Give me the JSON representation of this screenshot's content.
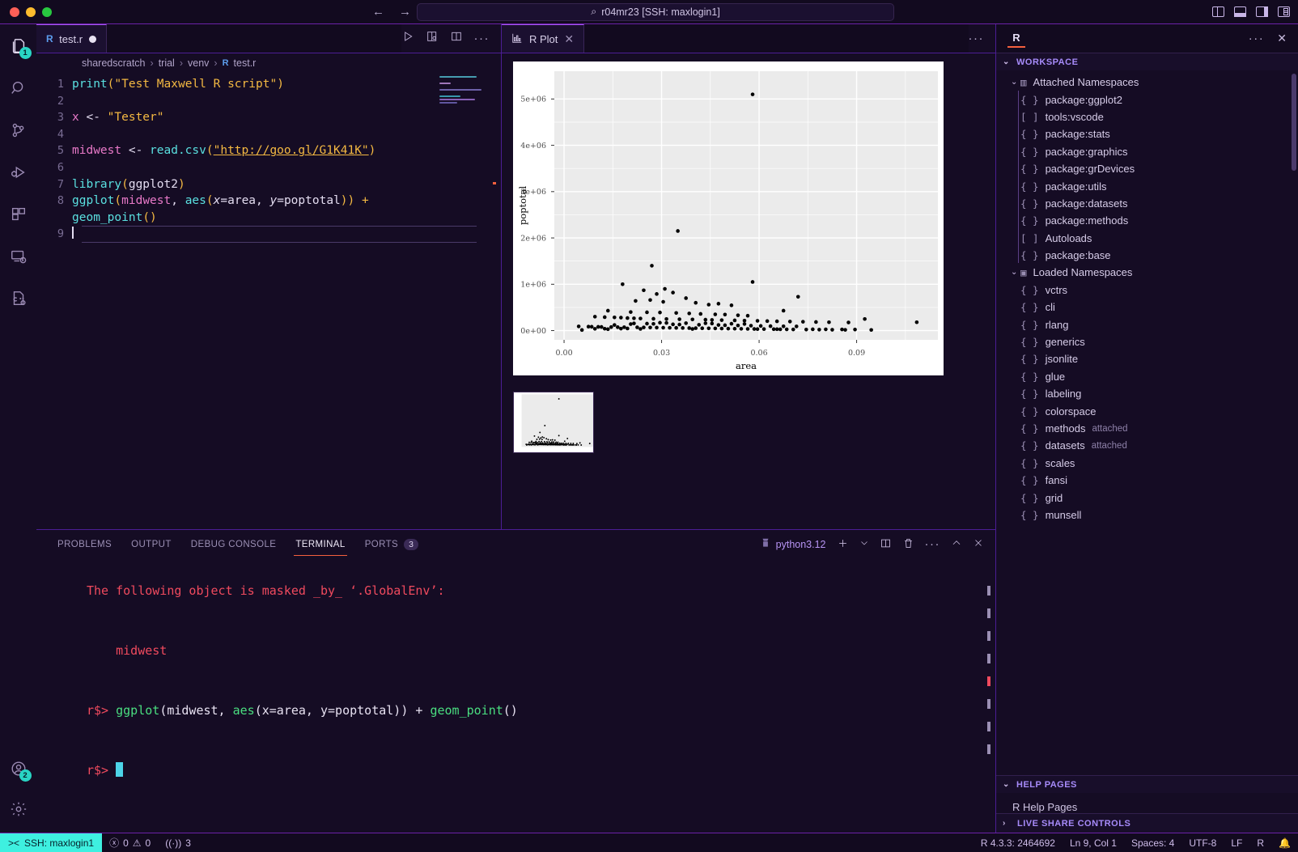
{
  "titlebar": {
    "window_title": "r04mr23 [SSH: maxlogin1]",
    "search_glyph": "⌕",
    "back_glyph": "←",
    "forward_glyph": "→"
  },
  "activitybar": {
    "items": [
      {
        "name": "explorer",
        "badge": "1"
      },
      {
        "name": "search",
        "badge": ""
      },
      {
        "name": "source-control",
        "badge": ""
      },
      {
        "name": "run-and-debug",
        "badge": ""
      },
      {
        "name": "extensions",
        "badge": ""
      },
      {
        "name": "remote-explorer",
        "badge": ""
      },
      {
        "name": "cpp-config",
        "badge": ""
      }
    ],
    "accounts_badge": "2"
  },
  "editor": {
    "tab": {
      "label": "test.r",
      "icon": "R",
      "dirty": true
    },
    "breadcrumb": [
      "sharedscratch",
      "trial",
      "venv",
      "test.r"
    ],
    "code_lines": [
      {
        "n": "1",
        "text": "print(\"Test Maxwell R script\")"
      },
      {
        "n": "2",
        "text": ""
      },
      {
        "n": "3",
        "text": "x <- \"Tester\""
      },
      {
        "n": "4",
        "text": ""
      },
      {
        "n": "5",
        "text": "midwest <- read.csv(\"http://goo.gl/G1K41K\")"
      },
      {
        "n": "6",
        "text": ""
      },
      {
        "n": "7",
        "text": "library(ggplot2)"
      },
      {
        "n": "8",
        "text": "ggplot(midwest, aes(x=area, y=poptotal)) +"
      },
      {
        "n": "",
        "text": "geom_point()"
      },
      {
        "n": "9",
        "text": ""
      }
    ]
  },
  "plot_panel": {
    "tab_label": "R Plot",
    "close_glyph": "✕",
    "more_glyph": "···"
  },
  "chart_data": {
    "type": "scatter",
    "title": "",
    "xlabel": "area",
    "ylabel": "poptotal",
    "xticks": [
      "0.00",
      "0.03",
      "0.06",
      "0.09"
    ],
    "yticks": [
      "0e+00",
      "1e+06",
      "2e+06",
      "3e+06",
      "4e+06",
      "5e+06"
    ],
    "xlim": [
      -0.003,
      0.115
    ],
    "ylim": [
      -200000,
      5600000
    ],
    "grid": true,
    "legend": "none",
    "points": [
      [
        0.058,
        5100000
      ],
      [
        0.035,
        2150000
      ],
      [
        0.027,
        1400000
      ],
      [
        0.058,
        1050000
      ],
      [
        0.018,
        1000000
      ],
      [
        0.031,
        900000
      ],
      [
        0.0245,
        870000
      ],
      [
        0.0335,
        820000
      ],
      [
        0.0285,
        790000
      ],
      [
        0.0375,
        700000
      ],
      [
        0.0265,
        660000
      ],
      [
        0.022,
        640000
      ],
      [
        0.0305,
        620000
      ],
      [
        0.0405,
        600000
      ],
      [
        0.0475,
        580000
      ],
      [
        0.0445,
        560000
      ],
      [
        0.0515,
        545000
      ],
      [
        0.072,
        730000
      ],
      [
        0.0675,
        430000
      ],
      [
        0.0135,
        430000
      ],
      [
        0.0205,
        400000
      ],
      [
        0.0255,
        395000
      ],
      [
        0.0295,
        390000
      ],
      [
        0.0345,
        380000
      ],
      [
        0.0385,
        370000
      ],
      [
        0.042,
        360000
      ],
      [
        0.0465,
        350000
      ],
      [
        0.0495,
        345000
      ],
      [
        0.0535,
        330000
      ],
      [
        0.0565,
        320000
      ],
      [
        0.0095,
        300000
      ],
      [
        0.0125,
        290000
      ],
      [
        0.0155,
        285000
      ],
      [
        0.0175,
        280000
      ],
      [
        0.0195,
        270000
      ],
      [
        0.0215,
        265000
      ],
      [
        0.0235,
        260000
      ],
      [
        0.0275,
        255000
      ],
      [
        0.0315,
        250000
      ],
      [
        0.0355,
        245000
      ],
      [
        0.0395,
        240000
      ],
      [
        0.0435,
        235000
      ],
      [
        0.0455,
        230000
      ],
      [
        0.0485,
        225000
      ],
      [
        0.0525,
        220000
      ],
      [
        0.0555,
        215000
      ],
      [
        0.0595,
        210000
      ],
      [
        0.0625,
        205000
      ],
      [
        0.0655,
        200000
      ],
      [
        0.0695,
        195000
      ],
      [
        0.0735,
        190000
      ],
      [
        0.0775,
        185000
      ],
      [
        0.0815,
        180000
      ],
      [
        0.0875,
        175000
      ],
      [
        0.0925,
        250000
      ],
      [
        0.1085,
        180000
      ],
      [
        0.0045,
        90000
      ],
      [
        0.0075,
        85000
      ],
      [
        0.0085,
        82000
      ],
      [
        0.0105,
        80000
      ],
      [
        0.0115,
        78000
      ],
      [
        0.0145,
        76000
      ],
      [
        0.0165,
        74000
      ],
      [
        0.0185,
        72000
      ],
      [
        0.0225,
        70000
      ],
      [
        0.0245,
        68000
      ],
      [
        0.0265,
        66000
      ],
      [
        0.0285,
        64000
      ],
      [
        0.0305,
        62000
      ],
      [
        0.0325,
        60000
      ],
      [
        0.0345,
        58000
      ],
      [
        0.0365,
        56000
      ],
      [
        0.0385,
        54000
      ],
      [
        0.0405,
        52000
      ],
      [
        0.0425,
        50000
      ],
      [
        0.0445,
        48000
      ],
      [
        0.0465,
        46000
      ],
      [
        0.0485,
        44000
      ],
      [
        0.0505,
        42000
      ],
      [
        0.0525,
        40000
      ],
      [
        0.0545,
        38000
      ],
      [
        0.0565,
        36000
      ],
      [
        0.0585,
        34000
      ],
      [
        0.0615,
        32000
      ],
      [
        0.0645,
        30000
      ],
      [
        0.0665,
        28000
      ],
      [
        0.0685,
        26000
      ],
      [
        0.0705,
        24000
      ],
      [
        0.0745,
        22000
      ],
      [
        0.0785,
        20000
      ],
      [
        0.0825,
        18000
      ],
      [
        0.0865,
        16000
      ],
      [
        0.0945,
        14000
      ],
      [
        0.0055,
        12000
      ],
      [
        0.0135,
        30000
      ],
      [
        0.0155,
        120000
      ],
      [
        0.0205,
        140000
      ],
      [
        0.0215,
        155000
      ],
      [
        0.0255,
        150000
      ],
      [
        0.0275,
        145000
      ],
      [
        0.0335,
        135000
      ],
      [
        0.0355,
        130000
      ],
      [
        0.0415,
        125000
      ],
      [
        0.0475,
        120000
      ],
      [
        0.0495,
        115000
      ],
      [
        0.0535,
        110000
      ],
      [
        0.0575,
        105000
      ],
      [
        0.0605,
        100000
      ],
      [
        0.0635,
        95000
      ],
      [
        0.0675,
        92000
      ],
      [
        0.0715,
        90000
      ],
      [
        0.0295,
        170000
      ],
      [
        0.0315,
        165000
      ],
      [
        0.0375,
        160000
      ],
      [
        0.0435,
        158000
      ],
      [
        0.0455,
        152000
      ],
      [
        0.0515,
        148000
      ],
      [
        0.0555,
        142000
      ],
      [
        0.0195,
        45000
      ],
      [
        0.0175,
        42000
      ],
      [
        0.0125,
        40000
      ],
      [
        0.0095,
        38000
      ],
      [
        0.0235,
        36000
      ],
      [
        0.0395,
        34000
      ],
      [
        0.0595,
        32000
      ],
      [
        0.0655,
        30000
      ],
      [
        0.0765,
        28000
      ],
      [
        0.0805,
        26000
      ],
      [
        0.0855,
        24000
      ],
      [
        0.0895,
        22000
      ]
    ]
  },
  "panel": {
    "tabs": [
      {
        "label": "PROBLEMS",
        "badge": ""
      },
      {
        "label": "OUTPUT",
        "badge": ""
      },
      {
        "label": "DEBUG CONSOLE",
        "badge": ""
      },
      {
        "label": "TERMINAL",
        "badge": ""
      },
      {
        "label": "PORTS",
        "badge": "3"
      }
    ],
    "active_tab": "TERMINAL",
    "terminal_name": "python3.12",
    "terminal_lines": [
      {
        "kind": "red",
        "text": "The following object is masked _by_ ‘.GlobalEnv’:"
      },
      {
        "kind": "blank",
        "text": ""
      },
      {
        "kind": "red-indent",
        "text": "    midwest"
      },
      {
        "kind": "blank",
        "text": ""
      },
      {
        "kind": "command",
        "prompt": "r$>",
        "text": "ggplot(midwest, aes(x=area, y=poptotal)) + geom_point()"
      },
      {
        "kind": "blank",
        "text": ""
      },
      {
        "kind": "prompt-cursor",
        "prompt": "r$>",
        "text": ""
      }
    ]
  },
  "sidebar": {
    "header_icon": "R",
    "more_glyph": "···",
    "close_glyph": "✕",
    "sections": [
      {
        "title": "WORKSPACE",
        "expanded": true
      },
      {
        "title": "HELP PAGES",
        "expanded": true
      },
      {
        "title": "LIVE SHARE CONTROLS",
        "expanded": false
      }
    ],
    "workspace": {
      "groups": [
        {
          "label": "Attached Namespaces",
          "icon": "namespaces-icon",
          "items": [
            {
              "glyph": "{ }",
              "label": "package:ggplot2",
              "sub": ""
            },
            {
              "glyph": "[ ]",
              "label": "tools:vscode",
              "sub": ""
            },
            {
              "glyph": "{ }",
              "label": "package:stats",
              "sub": ""
            },
            {
              "glyph": "{ }",
              "label": "package:graphics",
              "sub": ""
            },
            {
              "glyph": "{ }",
              "label": "package:grDevices",
              "sub": ""
            },
            {
              "glyph": "{ }",
              "label": "package:utils",
              "sub": ""
            },
            {
              "glyph": "{ }",
              "label": "package:datasets",
              "sub": ""
            },
            {
              "glyph": "{ }",
              "label": "package:methods",
              "sub": ""
            },
            {
              "glyph": "[ ]",
              "label": "Autoloads",
              "sub": ""
            },
            {
              "glyph": "{ }",
              "label": "package:base",
              "sub": ""
            }
          ]
        },
        {
          "label": "Loaded Namespaces",
          "icon": "package-icon",
          "items": [
            {
              "glyph": "{ }",
              "label": "vctrs",
              "sub": ""
            },
            {
              "glyph": "{ }",
              "label": "cli",
              "sub": ""
            },
            {
              "glyph": "{ }",
              "label": "rlang",
              "sub": ""
            },
            {
              "glyph": "{ }",
              "label": "generics",
              "sub": ""
            },
            {
              "glyph": "{ }",
              "label": "jsonlite",
              "sub": ""
            },
            {
              "glyph": "{ }",
              "label": "glue",
              "sub": ""
            },
            {
              "glyph": "{ }",
              "label": "labeling",
              "sub": ""
            },
            {
              "glyph": "{ }",
              "label": "colorspace",
              "sub": ""
            },
            {
              "glyph": "{ }",
              "label": "methods",
              "sub": "attached"
            },
            {
              "glyph": "{ }",
              "label": "datasets",
              "sub": "attached"
            },
            {
              "glyph": "{ }",
              "label": "scales",
              "sub": ""
            },
            {
              "glyph": "{ }",
              "label": "fansi",
              "sub": ""
            },
            {
              "glyph": "{ }",
              "label": "grid",
              "sub": ""
            },
            {
              "glyph": "{ }",
              "label": "munsell",
              "sub": ""
            }
          ]
        }
      ]
    },
    "help_pages": {
      "item": "R Help Pages"
    }
  },
  "statusbar": {
    "remote": "SSH: maxlogin1",
    "errors": "0",
    "warnings": "0",
    "ports": "3",
    "r_version": "R 4.3.3: 2464692",
    "cursor": "Ln 9, Col 1",
    "spaces": "Spaces: 4",
    "encoding": "UTF-8",
    "eol": "LF",
    "language": "R"
  }
}
